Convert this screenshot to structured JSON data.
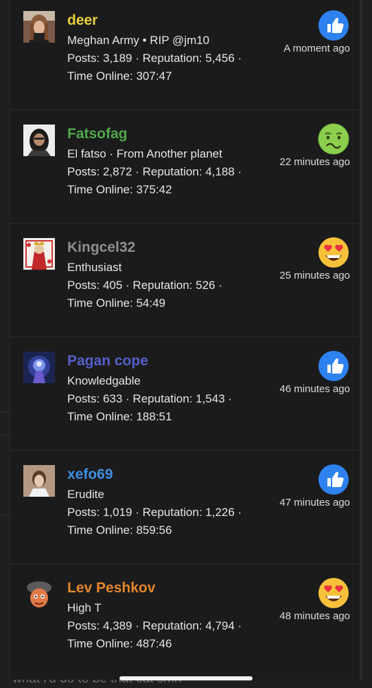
{
  "colors": {
    "panel_bg": "#1b1b1b",
    "text": "#e6e6e6",
    "like_blue": "#2e82f0"
  },
  "reactions_list": [
    {
      "name": "deer",
      "name_color": "#e9cf3b",
      "title": "Meghan Army • RIP @jm10",
      "stats_line1": "Posts: 3,189 · Reputation: 5,456 ·",
      "stats_line2": "Time Online: 307:47",
      "reaction_icon": "like-icon",
      "time": "A moment ago"
    },
    {
      "name": "Fatsofag",
      "name_color": "#4fa84c",
      "title": "El fatso · From Another planet",
      "stats_line1": "Posts: 2,872 · Reputation: 4,188 ·",
      "stats_line2": "Time Online: 375:42",
      "reaction_icon": "nauseated-face-icon",
      "time": "22 minutes ago"
    },
    {
      "name": "Kingcel32",
      "name_color": "#8e8e8e",
      "title": "Enthusiast",
      "stats_line1": "Posts: 405 · Reputation: 526 ·",
      "stats_line2": "Time Online: 54:49",
      "reaction_icon": "heart-eyes-icon",
      "time": "25 minutes ago"
    },
    {
      "name": "Pagan cope",
      "name_color": "#5560c8",
      "title": "Knowledgable",
      "stats_line1": "Posts: 633 · Reputation: 1,543 ·",
      "stats_line2": "Time Online: 188:51",
      "reaction_icon": "like-icon",
      "time": "46 minutes ago"
    },
    {
      "name": "xefo69",
      "name_color": "#3d8fe0",
      "title": "Erudite",
      "stats_line1": "Posts: 1,019 · Reputation: 1,226 ·",
      "stats_line2": "Time Online: 859:56",
      "reaction_icon": "like-icon",
      "time": "47 minutes ago"
    },
    {
      "name": "Lev Peshkov",
      "name_color": "#e4862c",
      "title": "High T",
      "stats_line1": "Posts: 4,389 · Reputation: 4,794 ·",
      "stats_line2": "Time Online: 487:46",
      "reaction_icon": "heart-eyes-icon",
      "time": "48 minutes ago"
    }
  ],
  "background_text": "what i'd do to be that cat smh"
}
